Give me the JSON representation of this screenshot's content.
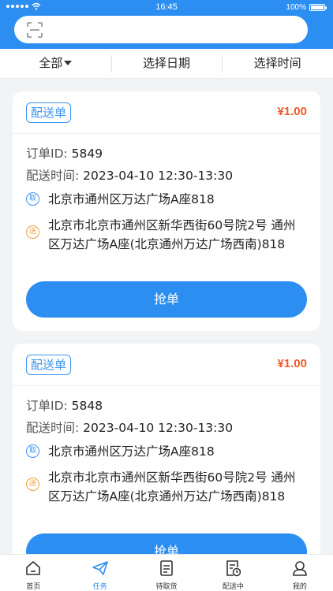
{
  "status_bar": {
    "time": "16:45",
    "battery": "100%"
  },
  "filters": [
    {
      "label": "全部"
    },
    {
      "label": "选择日期"
    },
    {
      "label": "选择时间"
    }
  ],
  "orders": [
    {
      "type": "配送单",
      "price": "¥1.00",
      "id_label": "订单ID:",
      "id": "5849",
      "time_label": "配送时间:",
      "time": "2023-04-10 12:30-13:30",
      "pickup_badge": "取",
      "pickup": "北京市通州区万达广场A座818",
      "dropoff_badge": "送",
      "dropoff": "北京市北京市通州区新华西街60号院2号 通州区万达广场A座(北京通州万达广场西南)818",
      "button": "抢单"
    },
    {
      "type": "配送单",
      "price": "¥1.00",
      "id_label": "订单ID:",
      "id": "5848",
      "time_label": "配送时间:",
      "time": "2023-04-10 12:30-13:30",
      "pickup_badge": "取",
      "pickup": "北京市通州区万达广场A座818",
      "dropoff_badge": "送",
      "dropoff": "北京市北京市通州区新华西街60号院2号 通州区万达广场A座(北京通州万达广场西南)818",
      "button": "抢单"
    }
  ],
  "tabs": [
    {
      "label": "首页",
      "icon": "home-icon"
    },
    {
      "label": "任务",
      "icon": "paper-plane-icon",
      "active": true
    },
    {
      "label": "待取货",
      "icon": "document-icon"
    },
    {
      "label": "配送中",
      "icon": "clock-document-icon"
    },
    {
      "label": "我的",
      "icon": "user-icon"
    }
  ],
  "colors": {
    "primary": "#2c8ef0",
    "price": "#f05a28",
    "send_badge": "#f0a040"
  }
}
